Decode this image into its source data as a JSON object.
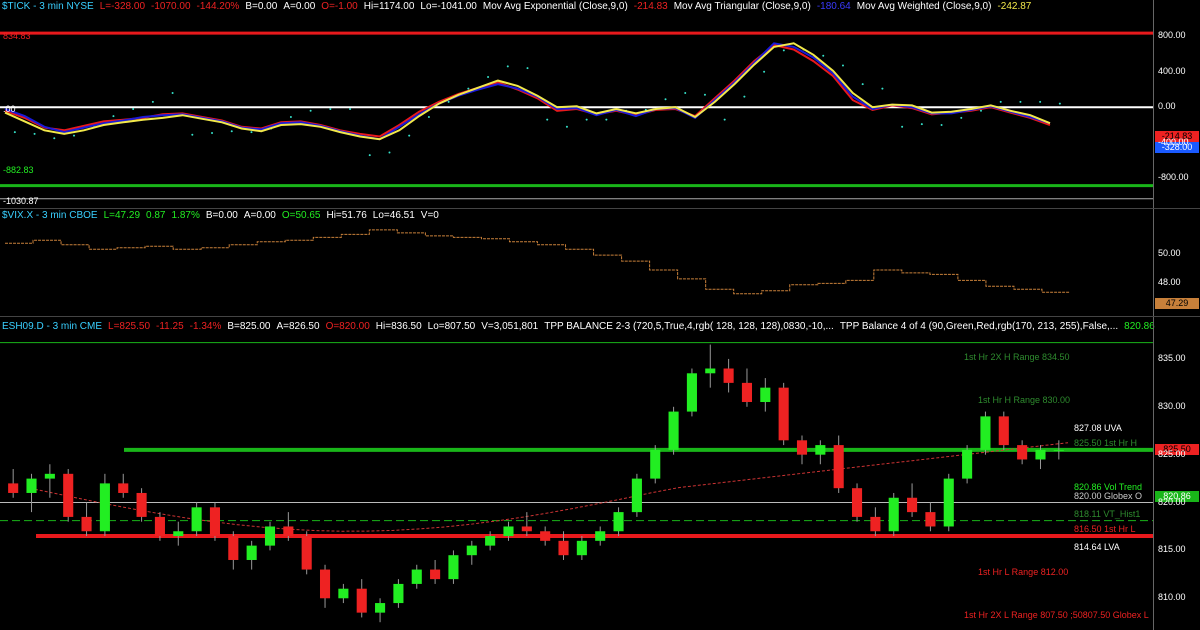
{
  "colors": {
    "up": "#22ee22",
    "down": "#ee2222",
    "red": "#e8191c",
    "green": "#19b519",
    "blue": "#1a1ad8",
    "yellow": "#f2e84a",
    "white": "#ffffff",
    "orange": "#c8803a",
    "cyan": "#35e0c8"
  },
  "tick_pane": {
    "header": {
      "symbol": "$TICK - 3 min  NYSE",
      "last": "L=-328.00",
      "chg": "-1070.00",
      "pct": "-144.20%",
      "bid": "B=0.00",
      "ask": "A=0.00",
      "open": "O=-1.00",
      "hi": "Hi=1174.00",
      "lo": "Lo=-1041.00",
      "ma1_label": "Mov Avg Exponential (Close,9,0)",
      "ma1_val": "-214.83",
      "ma2_label": "Mov Avg Triangular (Close,9,0)",
      "ma2_val": "-180.64",
      "ma3_label": "Mov Avg Weighted (Close,9,0)",
      "ma3_val": "-242.87"
    },
    "level_labels": {
      "top": "834.83",
      "zero": ".00",
      "low": "-882.83",
      "bottom": "-1030.87"
    },
    "tags": {
      "a": "-214.83",
      "b": "-328.00"
    }
  },
  "vix_pane": {
    "header": {
      "symbol": "$VIX.X - 3 min  CBOE",
      "last": "L=47.29",
      "chg": "0.87",
      "pct": "1.87%",
      "bid": "B=0.00",
      "ask": "A=0.00",
      "open": "O=50.65",
      "hi": "Hi=51.76",
      "lo": "Lo=46.51",
      "vol": "V=0"
    },
    "tag": "47.29"
  },
  "es_pane": {
    "header": {
      "symbol": "ESH09.D - 3 min  CME",
      "last": "L=825.50",
      "chg": "-11.25",
      "pct": "-1.34%",
      "bid": "B=825.00",
      "ask": "A=826.50",
      "open": "O=820.00",
      "hi": "Hi=836.50",
      "lo": "Lo=807.50",
      "vol": "V=3,051,801",
      "ind1": "TPP BALANCE 2-3 (720,5,True,4,rgb( 128, 128, 128),0830,-10,...",
      "ind2": "TPP Balance 4 of 4 (90,Green,Red,rgb(170, 213, 255),False,...",
      "ind2_val": "820.86"
    },
    "levels": [
      {
        "text": "1st Hr 2X H Range 834.50",
        "price": 834.5,
        "color": "#2e8b2e"
      },
      {
        "text": "1st Hr H Range 830.00",
        "price": 830.0,
        "color": "#2e8b2e"
      },
      {
        "text": "827.08 UVA",
        "price": 827.08,
        "color": "#ffffff"
      },
      {
        "text": "825.50 1st Hr H",
        "price": 825.5,
        "color": "#2e8b2e"
      },
      {
        "text": "820.86 Vol Trend",
        "price": 820.86,
        "color": "#22ee22"
      },
      {
        "text": "820.00  Globex O",
        "price": 820.0,
        "color": "#cccccc"
      },
      {
        "text": "818.11 VT_Hist1",
        "price": 818.11,
        "color": "#2e8b2e"
      },
      {
        "text": "816.50 1st Hr L",
        "price": 816.5,
        "color": "#ee2222"
      },
      {
        "text": "814.64 LVA",
        "price": 814.64,
        "color": "#ffffff"
      },
      {
        "text": "1st Hr L Range 812.00",
        "price": 812.0,
        "color": "#ee2222"
      },
      {
        "text": "1st Hr 2X L Range 807.50 ;50807.50   Globex L",
        "price": 807.5,
        "color": "#ee2222"
      }
    ],
    "tags": {
      "a": "825.50",
      "b": "820.86"
    }
  },
  "chart_data": [
    {
      "type": "line",
      "title": "$TICK - 3 min",
      "ylim": [
        -1090,
        1050
      ],
      "y_ticks": [
        800,
        400,
        0,
        -400,
        -800
      ],
      "series": [
        {
          "name": "Mov Avg Exponential (Close,9,0)",
          "values": [
            -40,
            -120,
            -230,
            -260,
            -210,
            -160,
            -140,
            -120,
            -80,
            -70,
            -110,
            -150,
            -220,
            -240,
            -170,
            -160,
            -200,
            -260,
            -300,
            -330,
            -200,
            -50,
            60,
            150,
            220,
            280,
            200,
            100,
            -40,
            -20,
            -80,
            -40,
            -90,
            -30,
            -20,
            -100,
            100,
            300,
            520,
            700,
            650,
            520,
            350,
            80,
            -30,
            20,
            -10,
            -80,
            -60,
            -40,
            0,
            -60,
            -120,
            -200
          ]
        },
        {
          "name": "Mov Avg Triangular (Close,9,0)",
          "values": [
            -20,
            -100,
            -220,
            -280,
            -230,
            -180,
            -150,
            -110,
            -90,
            -80,
            -120,
            -160,
            -230,
            -250,
            -180,
            -170,
            -210,
            -270,
            -320,
            -360,
            -220,
            -80,
            40,
            130,
            200,
            260,
            210,
            120,
            -20,
            -10,
            -90,
            -30,
            -100,
            -20,
            -10,
            -120,
            80,
            280,
            500,
            720,
            680,
            560,
            380,
            120,
            -20,
            30,
            0,
            -70,
            -70,
            -30,
            10,
            -50,
            -110,
            -180
          ]
        },
        {
          "name": "Mov Avg Weighted (Close,9,0)",
          "values": [
            -60,
            -160,
            -260,
            -300,
            -260,
            -200,
            -170,
            -140,
            -120,
            -90,
            -130,
            -170,
            -240,
            -270,
            -200,
            -190,
            -220,
            -280,
            -330,
            -360,
            -260,
            -100,
            40,
            140,
            220,
            300,
            240,
            130,
            0,
            10,
            -70,
            -20,
            -70,
            -20,
            0,
            -110,
            60,
            260,
            480,
            680,
            720,
            590,
            410,
            160,
            0,
            30,
            20,
            -60,
            -50,
            -20,
            20,
            -40,
            -90,
            -180
          ]
        }
      ]
    },
    {
      "type": "line",
      "title": "$VIX.X - 3 min",
      "ylim": [
        46.0,
        52.2
      ],
      "y_ticks": [
        50.0,
        48.0
      ],
      "series": [
        {
          "name": "$VIX.X",
          "values": [
            50.7,
            50.9,
            50.6,
            50.3,
            50.4,
            50.5,
            50.3,
            50.4,
            50.6,
            50.8,
            50.9,
            51.1,
            51.3,
            51.6,
            51.4,
            51.2,
            51.1,
            51.0,
            50.8,
            50.6,
            50.3,
            49.9,
            49.5,
            48.9,
            48.3,
            47.6,
            47.3,
            47.5,
            47.9,
            48.0,
            48.2,
            48.9,
            48.7,
            48.6,
            48.2,
            47.8,
            47.6,
            47.4
          ]
        }
      ]
    },
    {
      "type": "candlestick",
      "title": "ESH09.D - 3 min",
      "ylim": [
        807.0,
        837.5
      ],
      "y_ticks": [
        835,
        830,
        825,
        820,
        815,
        810
      ],
      "ohlc": [
        [
          822,
          823.5,
          820.5,
          821
        ],
        [
          821,
          823,
          819,
          822.5
        ],
        [
          822.5,
          824,
          820.5,
          823
        ],
        [
          823,
          823.5,
          818,
          818.5
        ],
        [
          818.5,
          820,
          816.5,
          817
        ],
        [
          817,
          823,
          816.5,
          822
        ],
        [
          822,
          823,
          820.5,
          821
        ],
        [
          821,
          821.5,
          818,
          818.5
        ],
        [
          818.5,
          819,
          816,
          816.5
        ],
        [
          816.5,
          818,
          815.5,
          817
        ],
        [
          817,
          820,
          816.5,
          819.5
        ],
        [
          819.5,
          820,
          816,
          816.5
        ],
        [
          816.5,
          817,
          813,
          814
        ],
        [
          814,
          816,
          813,
          815.5
        ],
        [
          815.5,
          818,
          815,
          817.5
        ],
        [
          817.5,
          819,
          816,
          816.5
        ],
        [
          816.5,
          817,
          812.5,
          813
        ],
        [
          813,
          813.5,
          809,
          810
        ],
        [
          810,
          811.5,
          809.5,
          811
        ],
        [
          811,
          812,
          808,
          808.5
        ],
        [
          808.5,
          810,
          807.5,
          809.5
        ],
        [
          809.5,
          812,
          809,
          811.5
        ],
        [
          811.5,
          813.5,
          811,
          813
        ],
        [
          813,
          814,
          811.5,
          812
        ],
        [
          812,
          815,
          811.5,
          814.5
        ],
        [
          814.5,
          816,
          813.5,
          815.5
        ],
        [
          815.5,
          817,
          815,
          816.5
        ],
        [
          816.5,
          818,
          816,
          817.5
        ],
        [
          817.5,
          819,
          816.5,
          817
        ],
        [
          817,
          817.5,
          815.5,
          816
        ],
        [
          816,
          817,
          814,
          814.5
        ],
        [
          814.5,
          816.5,
          814,
          816
        ],
        [
          816,
          817.5,
          815.5,
          817
        ],
        [
          817,
          819.5,
          816.5,
          819
        ],
        [
          819,
          823,
          818.5,
          822.5
        ],
        [
          822.5,
          826,
          822,
          825.5
        ],
        [
          825.5,
          830,
          825,
          829.5
        ],
        [
          829.5,
          834,
          829,
          833.5
        ],
        [
          833.5,
          836.5,
          832,
          834
        ],
        [
          834,
          835,
          831.5,
          832.5
        ],
        [
          832.5,
          834,
          830,
          830.5
        ],
        [
          830.5,
          833,
          829.5,
          832
        ],
        [
          832,
          832.5,
          826,
          826.5
        ],
        [
          826.5,
          827,
          824,
          825
        ],
        [
          825,
          826.5,
          824,
          826
        ],
        [
          826,
          827,
          821,
          821.5
        ],
        [
          821.5,
          822,
          818,
          818.5
        ],
        [
          818.5,
          819.5,
          816.5,
          817
        ],
        [
          817,
          821,
          816.5,
          820.5
        ],
        [
          820.5,
          822,
          818.5,
          819
        ],
        [
          819,
          820,
          817,
          817.5
        ],
        [
          817.5,
          823,
          817,
          822.5
        ],
        [
          822.5,
          826,
          822,
          825.5
        ],
        [
          825.5,
          829.5,
          825,
          829
        ],
        [
          829,
          829.5,
          825.5,
          826
        ],
        [
          826,
          826.5,
          824,
          824.5
        ],
        [
          824.5,
          826,
          823.5,
          825.5
        ],
        [
          825.5,
          826.5,
          824.5,
          825.5
        ]
      ]
    }
  ]
}
